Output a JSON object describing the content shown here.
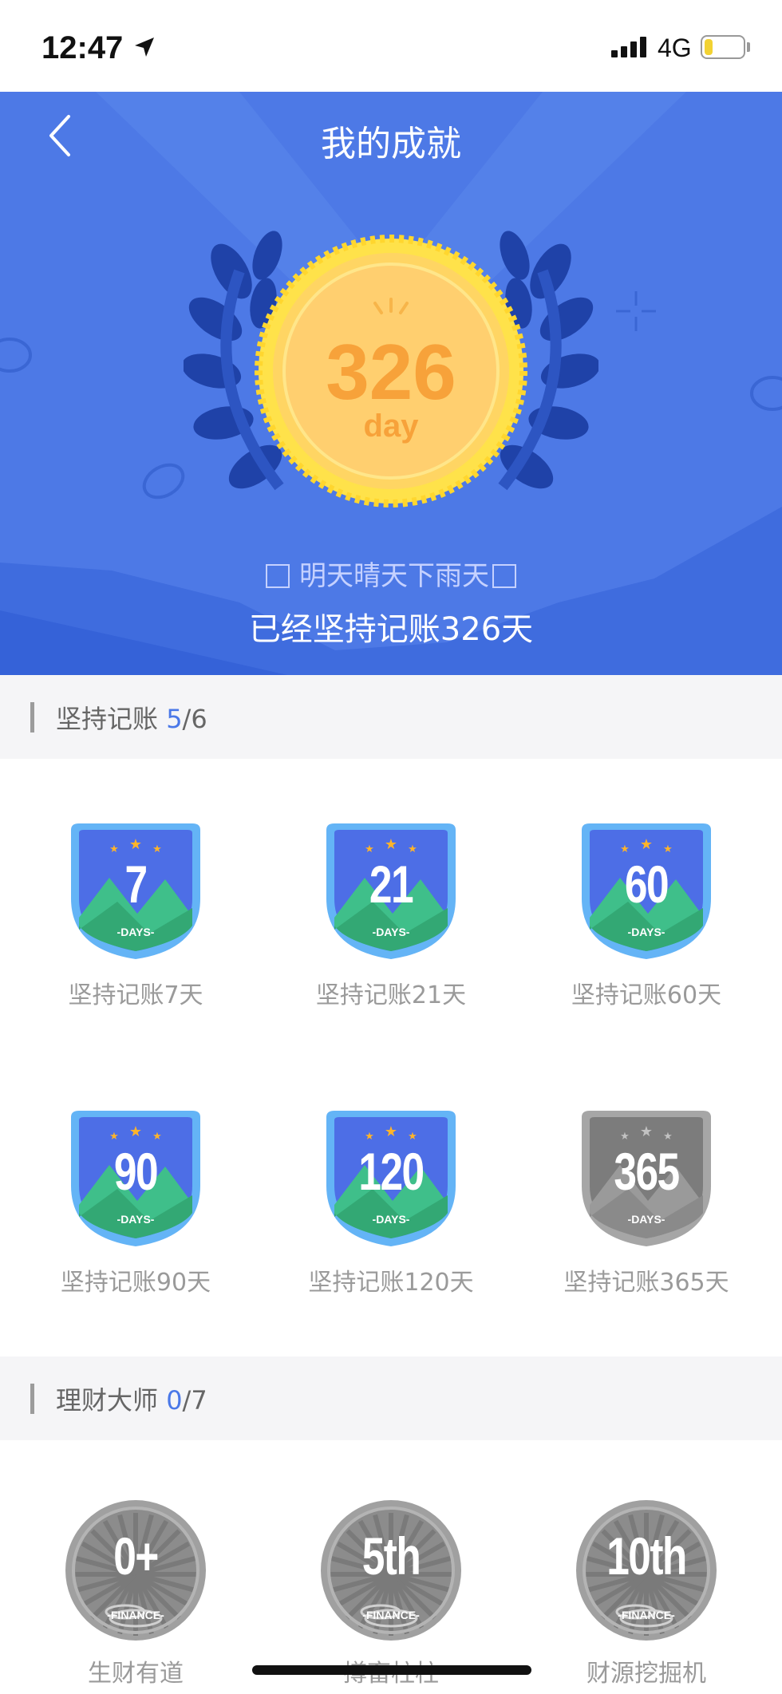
{
  "status": {
    "time": "12:47",
    "network": "4G",
    "battery_level": 0.2,
    "battery_color": "#f2d233"
  },
  "header": {
    "title": "我的成就"
  },
  "hero": {
    "medal_value": "326",
    "medal_unit": "day",
    "motto": "明天晴天下雨天",
    "persist_text": "已经坚持记账326天",
    "bg_color": "#4d79e6"
  },
  "sections": [
    {
      "title": "坚持记账",
      "progress_done": "5",
      "progress_total": "/6"
    },
    {
      "title": "理财大师",
      "progress_done": "0",
      "progress_total": "/7"
    }
  ],
  "streak_badges": [
    {
      "number": "7",
      "sub": "-DAYS-",
      "label": "坚持记账7天",
      "achieved": true
    },
    {
      "number": "21",
      "sub": "-DAYS-",
      "label": "坚持记账21天",
      "achieved": true
    },
    {
      "number": "60",
      "sub": "-DAYS-",
      "label": "坚持记账60天",
      "achieved": true
    },
    {
      "number": "90",
      "sub": "-DAYS-",
      "label": "坚持记账90天",
      "achieved": true
    },
    {
      "number": "120",
      "sub": "-DAYS-",
      "label": "坚持记账120天",
      "achieved": true
    },
    {
      "number": "365",
      "sub": "-DAYS-",
      "label": "坚持记账365天",
      "achieved": false
    }
  ],
  "finance_badges": [
    {
      "number": "0+",
      "sub": "-FINANCE-",
      "label": "生财有道",
      "achieved": false
    },
    {
      "number": "5th",
      "sub": "-FINANCE-",
      "label": "撙畜柱柱",
      "achieved": false
    },
    {
      "number": "10th",
      "sub": "-FINANCE-",
      "label": "财源挖掘机",
      "achieved": false
    }
  ]
}
